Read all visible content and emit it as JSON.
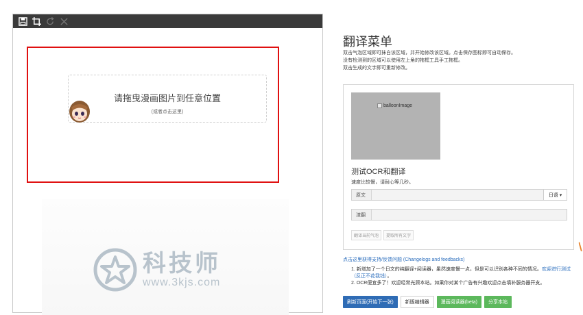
{
  "editor": {
    "toolbar": {
      "icons": [
        "save-icon",
        "crop-icon",
        "redo-icon",
        "close-icon"
      ]
    },
    "dropzone": {
      "main": "请拖曳漫画图片到任意位置",
      "sub": "(或者点击这里)"
    },
    "watermark": {
      "text": "科技师",
      "url": "www.3kjs.com"
    }
  },
  "panel": {
    "title": "翻译菜单",
    "desc": [
      "双击气泡区域即可抹白该区域，并开始修改该区域。点击保存图标即可自动保存。",
      "没有检测到的区域可以使用左上角的拖框工具手工拖框。",
      "双击生成的文字即可重新修改。"
    ],
    "card": {
      "balloon_alt": "balloonImage",
      "ocr_title": "测试OCR和翻译",
      "ocr_note": "速度比较慢，请耐心等几秒。",
      "original_label": "原文",
      "language": "日语 ▾",
      "translation_label": "渣翻",
      "translate_bubble": "翻译当前气泡",
      "extract_all": "提取所有文字"
    },
    "support_link": "点击这里获得支持/反馈问题 (Changelogs and feedbacks)",
    "notes": {
      "n1": "1. 新增加了一个日文的纯翻译+阅读器，虽然速度慢一点，但是可以识别各种不同的情况。",
      "n1_link": "欢迎进行测试（反正不花我钱）",
      "n1_end": "。",
      "n2": "2. OCR便宜多了！欢迎经常光顾本站。如果你对某个广告有兴趣欢迎点击填补服务器开支。"
    },
    "buttons": {
      "refresh": "刷新页面(开始下一张)",
      "new_editor": "新版编辑器",
      "reader": "漫画阅读器(beta)",
      "share": "分享本站"
    }
  },
  "colors": {
    "toolbar": "#3a3a3a",
    "highlight": "#e01010",
    "primary": "#2f6cb5",
    "success": "#5cb85c",
    "link": "#2a6dbd"
  }
}
